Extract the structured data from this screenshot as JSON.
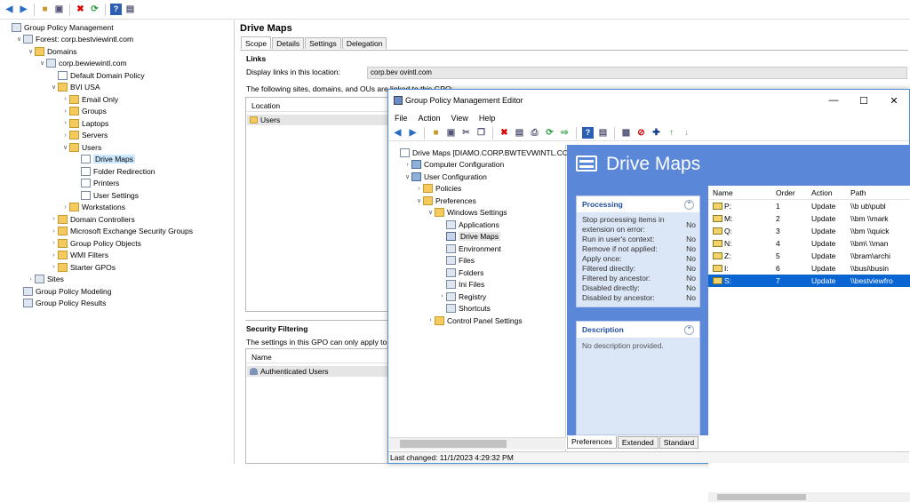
{
  "toolbar_icons": [
    "back-icon",
    "forward-icon",
    "up-folder-icon",
    "console-tree-icon",
    "delete-icon",
    "refresh-icon",
    "help-icon",
    "properties-icon"
  ],
  "left_tree": [
    {
      "label": "Group Policy Management",
      "indent": 0,
      "icon": "gpm-icon",
      "chev": ""
    },
    {
      "label": "Forest: corp.bestviewintl.com",
      "indent": 1,
      "icon": "forest-icon",
      "chev": "v"
    },
    {
      "label": "Domains",
      "indent": 2,
      "icon": "folder-icon",
      "chev": "v"
    },
    {
      "label": "corp.bewiewintl.com",
      "indent": 3,
      "icon": "domain-icon",
      "chev": "v"
    },
    {
      "label": "Default Domain Policy",
      "indent": 4,
      "icon": "gpo-icon",
      "chev": ""
    },
    {
      "label": "BVI USA",
      "indent": 4,
      "icon": "folder-icon",
      "chev": "v"
    },
    {
      "label": "Email Only",
      "indent": 5,
      "icon": "folder-icon",
      "chev": ">"
    },
    {
      "label": "Groups",
      "indent": 5,
      "icon": "folder-icon",
      "chev": ">"
    },
    {
      "label": "Laptops",
      "indent": 5,
      "icon": "folder-icon",
      "chev": ">"
    },
    {
      "label": "Servers",
      "indent": 5,
      "icon": "folder-icon",
      "chev": ">"
    },
    {
      "label": "Users",
      "indent": 5,
      "icon": "folder-icon",
      "chev": "v"
    },
    {
      "label": "Drive Maps",
      "indent": 6,
      "icon": "gpo-icon",
      "chev": "",
      "selected": true
    },
    {
      "label": "Folder Redirection",
      "indent": 6,
      "icon": "gpo-icon",
      "chev": ""
    },
    {
      "label": "Printers",
      "indent": 6,
      "icon": "gpo-icon",
      "chev": ""
    },
    {
      "label": "User Settings",
      "indent": 6,
      "icon": "gpo-icon",
      "chev": ""
    },
    {
      "label": "Workstations",
      "indent": 5,
      "icon": "folder-icon",
      "chev": ">"
    },
    {
      "label": "Domain Controllers",
      "indent": 4,
      "icon": "folder-icon",
      "chev": ">"
    },
    {
      "label": "Microsoft Exchange Security Groups",
      "indent": 4,
      "icon": "folder-icon",
      "chev": ">"
    },
    {
      "label": "Group Policy Objects",
      "indent": 4,
      "icon": "folder-icon",
      "chev": ">"
    },
    {
      "label": "WMI Filters",
      "indent": 4,
      "icon": "folder-icon",
      "chev": ">"
    },
    {
      "label": "Starter GPOs",
      "indent": 4,
      "icon": "folder-icon",
      "chev": ">"
    },
    {
      "label": "Sites",
      "indent": 2,
      "icon": "sites-icon",
      "chev": ">"
    },
    {
      "label": "Group Policy Modeling",
      "indent": 1,
      "icon": "modeling-icon",
      "chev": ""
    },
    {
      "label": "Group Policy Results",
      "indent": 1,
      "icon": "results-icon",
      "chev": ""
    }
  ],
  "right": {
    "title": "Drive Maps",
    "tabs": [
      "Scope",
      "Details",
      "Settings",
      "Delegation"
    ],
    "links_heading": "Links",
    "display_links_label": "Display links in this location:",
    "display_links_value": "corp.bev        ovintl.com",
    "following_text": "The following sites, domains, and OUs are linked to this GPO:",
    "location_col": "Location",
    "location_row": "Users",
    "security_heading": "Security Filtering",
    "security_text": "The settings in this GPO can only apply to the",
    "name_col": "Name",
    "name_row": "Authenticated Users"
  },
  "gpme": {
    "title": "Group Policy Management Editor",
    "menu": [
      "File",
      "Action",
      "View",
      "Help"
    ],
    "tree": [
      {
        "label": "Drive Maps [DIAMO.CORP.BWTEVWINTL.CO",
        "indent": 0,
        "chev": "",
        "icon": "gpo-icon"
      },
      {
        "label": "Computer Configuration",
        "indent": 1,
        "chev": ">",
        "icon": "computer-icon"
      },
      {
        "label": "User Configuration",
        "indent": 1,
        "chev": "v",
        "icon": "user-icon"
      },
      {
        "label": "Policies",
        "indent": 2,
        "chev": ">",
        "icon": "folder-icon"
      },
      {
        "label": "Preferences",
        "indent": 2,
        "chev": "v",
        "icon": "folder-icon"
      },
      {
        "label": "Windows Settings",
        "indent": 3,
        "chev": "v",
        "icon": "folder-icon"
      },
      {
        "label": "Applications",
        "indent": 4,
        "chev": "",
        "icon": "applications-icon"
      },
      {
        "label": "Drive Maps",
        "indent": 4,
        "chev": "",
        "icon": "drive-icon",
        "selected": true
      },
      {
        "label": "Environment",
        "indent": 4,
        "chev": "",
        "icon": "environment-icon"
      },
      {
        "label": "Files",
        "indent": 4,
        "chev": "",
        "icon": "files-icon"
      },
      {
        "label": "Folders",
        "indent": 4,
        "chev": "",
        "icon": "folders-icon"
      },
      {
        "label": "Ini Files",
        "indent": 4,
        "chev": "",
        "icon": "ini-icon"
      },
      {
        "label": "Registry",
        "indent": 4,
        "chev": ">",
        "icon": "registry-icon"
      },
      {
        "label": "Shortcuts",
        "indent": 4,
        "chev": "",
        "icon": "shortcut-icon"
      },
      {
        "label": "Control Panel Settings",
        "indent": 3,
        "chev": ">",
        "icon": "folder-icon"
      }
    ],
    "banner_title": "Drive Maps",
    "processing": {
      "title": "Processing",
      "rows": [
        {
          "k": "Stop processing items in extension on error:",
          "v": "No"
        },
        {
          "k": "Run in user's context:",
          "v": "No"
        },
        {
          "k": "Remove if not applied:",
          "v": "No"
        },
        {
          "k": "Apply once:",
          "v": "No"
        },
        {
          "k": "Filtered directly:",
          "v": "No"
        },
        {
          "k": "Filtered by ancestor:",
          "v": "No"
        },
        {
          "k": "Disabled directly:",
          "v": "No"
        },
        {
          "k": "Disabled by ancestor:",
          "v": "No"
        }
      ]
    },
    "description": {
      "title": "Description",
      "text": "No description provided."
    },
    "list_headers": [
      "Name",
      "Order",
      "Action",
      "Path"
    ],
    "list_rows": [
      {
        "name": "P:",
        "order": "1",
        "action": "Update",
        "path": "\\\\b   ub\\publ"
      },
      {
        "name": "M:",
        "order": "2",
        "action": "Update",
        "path": "\\\\bm   \\\\mark"
      },
      {
        "name": "Q:",
        "order": "3",
        "action": "Update",
        "path": "\\\\bm  \\\\quick"
      },
      {
        "name": "N:",
        "order": "4",
        "action": "Update",
        "path": "\\\\bm\\ \\\\man"
      },
      {
        "name": "Z:",
        "order": "5",
        "action": "Update",
        "path": "\\\\bram\\archi"
      },
      {
        "name": "I:",
        "order": "6",
        "action": "Update",
        "path": "\\\\busi\\busin"
      },
      {
        "name": "S:",
        "order": "7",
        "action": "Update",
        "path": "\\\\bestviewfro",
        "selected": true
      }
    ],
    "bottom_tabs": [
      "Preferences",
      "Extended",
      "Standard"
    ],
    "status": "Last changed: 11/1/2023 4:29:32 PM"
  }
}
